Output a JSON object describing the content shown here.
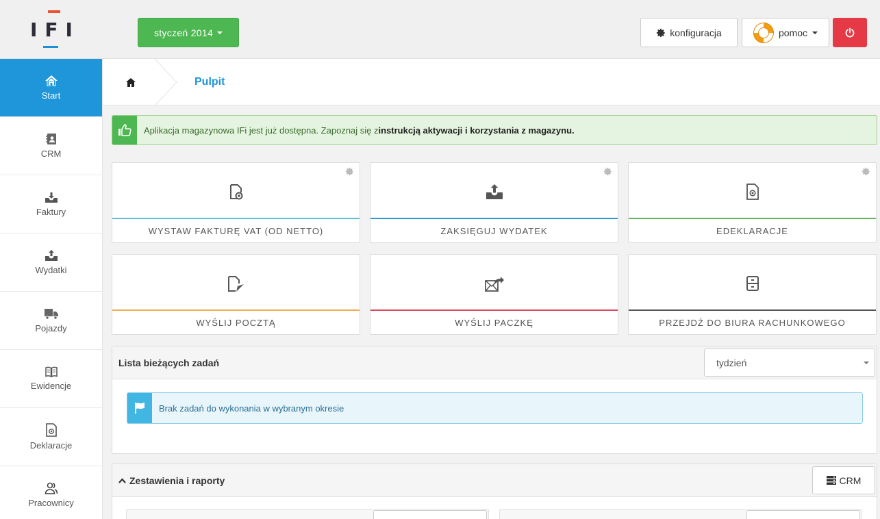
{
  "header": {
    "logo_text": "IFI",
    "month_label": "styczeń 2014",
    "config_label": "konfiguracja",
    "help_label": "pomoc"
  },
  "sidebar": {
    "items": [
      {
        "label": "Start",
        "icon": "home-icon",
        "active": true
      },
      {
        "label": "CRM",
        "icon": "contacts-icon"
      },
      {
        "label": "Faktury",
        "icon": "invoice-upload-icon"
      },
      {
        "label": "Wydatki",
        "icon": "expense-upload-icon"
      },
      {
        "label": "Pojazdy",
        "icon": "truck-icon"
      },
      {
        "label": "Ewidencje",
        "icon": "book-icon"
      },
      {
        "label": "Deklaracje",
        "icon": "declaration-icon"
      },
      {
        "label": "Pracownicy",
        "icon": "users-icon"
      }
    ]
  },
  "breadcrumb": {
    "title": "Pulpit"
  },
  "alert": {
    "text": "Aplikacja magazynowa IFi jest już dostępna. Zapoznaj się z ",
    "link": "instrukcją aktywacji i korzystania z magazynu."
  },
  "tiles": [
    {
      "label": "WYSTAW FAKTURĘ VAT (OD NETTO)",
      "color": "#5bc0de",
      "icon": "new-invoice-icon"
    },
    {
      "label": "ZAKSIĘGUJ WYDATEK",
      "color": "#2a9fd6",
      "icon": "upload-expense-icon"
    },
    {
      "label": "EDEKLARACJE",
      "color": "#5cb85c",
      "icon": "edeclaration-icon"
    },
    {
      "label": "WYŚLIJ POCZTĄ",
      "color": "#f0ad4e",
      "icon": "send-mail-icon"
    },
    {
      "label": "WYŚLIJ PACZKĘ",
      "color": "#e0495b",
      "icon": "send-package-icon"
    },
    {
      "label": "PRZEJDŹ DO BIURA RACHUNKOWEGO",
      "color": "#555555",
      "icon": "cabinet-icon"
    }
  ],
  "tasks": {
    "title": "Lista bieżących zadań",
    "period": "tydzień",
    "empty_message": "Brak zadań do wykonania w wybranym okresie"
  },
  "reports": {
    "title": "Zestawienia i raporty",
    "crm_button": "CRM"
  },
  "colors": {
    "accent": "#1e96d9",
    "green": "#4db852",
    "danger": "#e63946"
  }
}
